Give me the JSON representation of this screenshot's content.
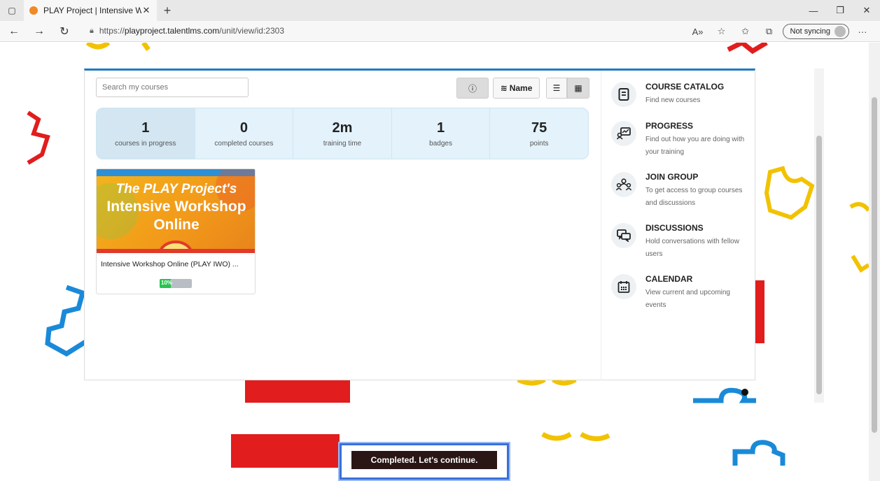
{
  "browser": {
    "tab_title": "PLAY Project | Intensive Worksho",
    "url_prefix": "https://",
    "url_host": "playproject.talentlms.com",
    "url_path": "/unit/view/id:2303",
    "sync_label": "Not syncing"
  },
  "toolbar": {
    "search_placeholder": "Search my courses",
    "sort_label": "Name"
  },
  "stats": [
    {
      "value": "1",
      "label": "courses in progress"
    },
    {
      "value": "0",
      "label": "completed courses"
    },
    {
      "value": "2m",
      "label": "training time"
    },
    {
      "value": "1",
      "label": "badges"
    },
    {
      "value": "75",
      "label": "points"
    }
  ],
  "course": {
    "image_line1": "The PLAY Project's",
    "image_line2": "Intensive Workshop",
    "image_line3": "Online",
    "title": "Intensive Workshop Online (PLAY IWO) ...",
    "progress_label": "10%",
    "progress_value": 0.1
  },
  "sidebar": {
    "items": [
      {
        "title": "COURSE CATALOG",
        "desc": "Find new courses",
        "icon": "book-icon"
      },
      {
        "title": "PROGRESS",
        "desc": "Find out how you are doing with your training",
        "icon": "progress-chart-icon"
      },
      {
        "title": "JOIN GROUP",
        "desc": "To get access to group courses and discussions",
        "icon": "group-icon"
      },
      {
        "title": "DISCUSSIONS",
        "desc": "Hold conversations with fellow users",
        "icon": "chat-icon"
      },
      {
        "title": "CALENDAR",
        "desc": "View current and upcoming events",
        "icon": "calendar-icon"
      }
    ]
  },
  "toast": {
    "message": "Completed. Let's continue."
  },
  "colors": {
    "accent_blue": "#1b7cc1",
    "stats_bg": "#e3f2fb",
    "progress_green": "#27c44e",
    "puzzle_red": "#e11d1d",
    "puzzle_yellow": "#f2c200",
    "puzzle_blue": "#1a8ad8"
  }
}
